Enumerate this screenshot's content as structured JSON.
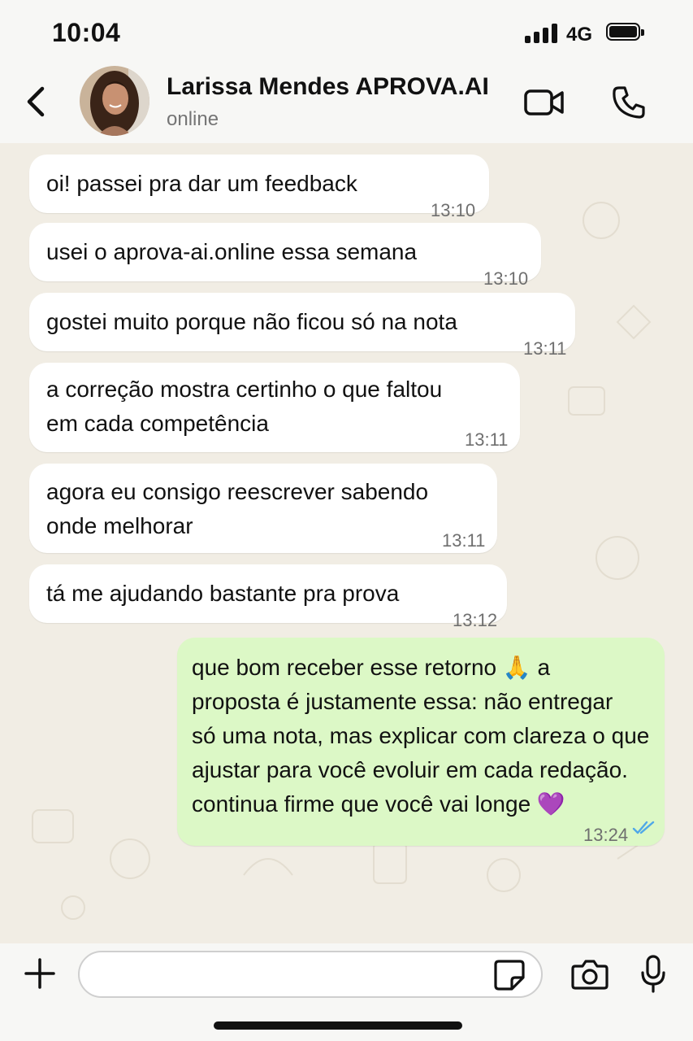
{
  "status_bar": {
    "time": "10:04",
    "network": "4G",
    "icons": [
      "signal-icon",
      "battery-icon"
    ]
  },
  "header": {
    "contact_name": "Larissa Mendes APROVA.AI",
    "contact_status": "online",
    "icons": [
      "back-chevron-icon",
      "avatar-photo",
      "video-call-icon",
      "phone-call-icon"
    ]
  },
  "messages": [
    {
      "direction": "incoming",
      "text": "oi! passei pra dar um feedback",
      "time": "13:10"
    },
    {
      "direction": "incoming",
      "text": "usei o aprova-ai.online essa semana",
      "time": "13:10"
    },
    {
      "direction": "incoming",
      "text": "gostei muito porque não ficou só na nota",
      "time": "13:11"
    },
    {
      "direction": "incoming",
      "text": "a correção mostra certinho o que faltou\nem cada competência",
      "time": "13:11"
    },
    {
      "direction": "incoming",
      "text": "agora eu consigo reescrever sabendo\nonde melhorar",
      "time": "13:11"
    },
    {
      "direction": "incoming",
      "text": "tá me ajudando bastante pra prova",
      "time": "13:12"
    },
    {
      "direction": "outgoing",
      "text": "que bom receber esse retorno 🙏 a\nproposta é justamente essa: não entregar\nsó uma nota, mas explicar com clareza o que\najustar para você evoluir em cada redação.\ncontinua firme que você vai longe 💜",
      "time": "13:24",
      "status": "read"
    }
  ],
  "input": {
    "value": "",
    "placeholder": ""
  },
  "input_icons": [
    "plus-icon",
    "sticker-icon",
    "camera-icon",
    "microphone-icon"
  ],
  "colors": {
    "incoming_bubble": "#ffffff",
    "outgoing_bubble": "#dcf8c6",
    "read_ticks": "#4fa8e8",
    "chat_background": "#f1ede4"
  }
}
